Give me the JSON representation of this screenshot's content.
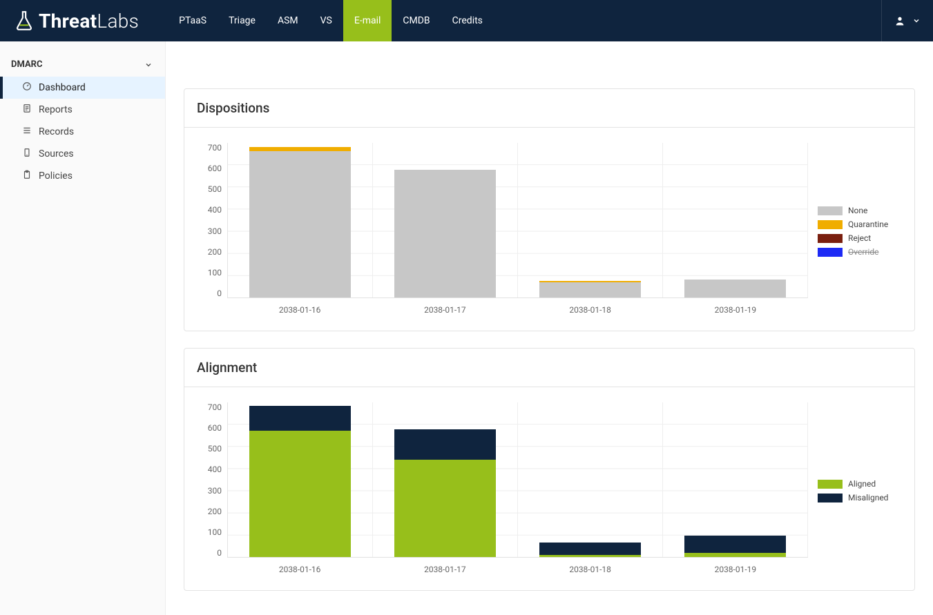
{
  "brand": {
    "bold": "Threat",
    "light": "Labs"
  },
  "nav": {
    "items": [
      {
        "label": "PTaaS"
      },
      {
        "label": "Triage"
      },
      {
        "label": "ASM"
      },
      {
        "label": "VS"
      },
      {
        "label": "E-mail",
        "active": true
      },
      {
        "label": "CMDB"
      },
      {
        "label": "Credits"
      }
    ]
  },
  "sidebar": {
    "group": "DMARC",
    "items": [
      {
        "label": "Dashboard",
        "icon": "gauge-icon",
        "active": true
      },
      {
        "label": "Reports",
        "icon": "doc-icon"
      },
      {
        "label": "Records",
        "icon": "list-icon"
      },
      {
        "label": "Sources",
        "icon": "device-icon"
      },
      {
        "label": "Policies",
        "icon": "clipboard-icon"
      }
    ]
  },
  "charts": {
    "dispositions": {
      "title": "Dispositions",
      "y_ticks": [
        "700",
        "600",
        "500",
        "400",
        "300",
        "200",
        "100",
        "0"
      ]
    },
    "alignment": {
      "title": "Alignment",
      "y_ticks": [
        "700",
        "600",
        "500",
        "400",
        "300",
        "200",
        "100",
        "0"
      ]
    }
  },
  "chart_data": [
    {
      "id": "dispositions",
      "type": "bar",
      "stacked": true,
      "title": "Dispositions",
      "categories": [
        "2038-01-16",
        "2038-01-17",
        "2038-01-18",
        "2038-01-19"
      ],
      "series": [
        {
          "name": "None",
          "color": "#c7c7c7",
          "values": [
            660,
            575,
            70,
            80
          ]
        },
        {
          "name": "Quarantine",
          "color": "#f0ad00",
          "values": [
            18,
            0,
            5,
            0
          ]
        },
        {
          "name": "Reject",
          "color": "#7a1f0f",
          "values": [
            0,
            0,
            0,
            0
          ]
        },
        {
          "name": "Override",
          "color": "#1d2af5",
          "values": [
            0,
            0,
            0,
            0
          ],
          "disabled": true
        }
      ],
      "ylim": [
        0,
        700
      ],
      "xlabel": "",
      "ylabel": ""
    },
    {
      "id": "alignment",
      "type": "bar",
      "stacked": true,
      "title": "Alignment",
      "categories": [
        "2038-01-16",
        "2038-01-17",
        "2038-01-18",
        "2038-01-19"
      ],
      "series": [
        {
          "name": "Aligned",
          "color": "#97bf1b",
          "values": [
            570,
            440,
            10,
            20
          ]
        },
        {
          "name": "Misaligned",
          "color": "#0f243e",
          "values": [
            110,
            135,
            55,
            75
          ]
        }
      ],
      "ylim": [
        0,
        700
      ],
      "xlabel": "",
      "ylabel": ""
    }
  ]
}
